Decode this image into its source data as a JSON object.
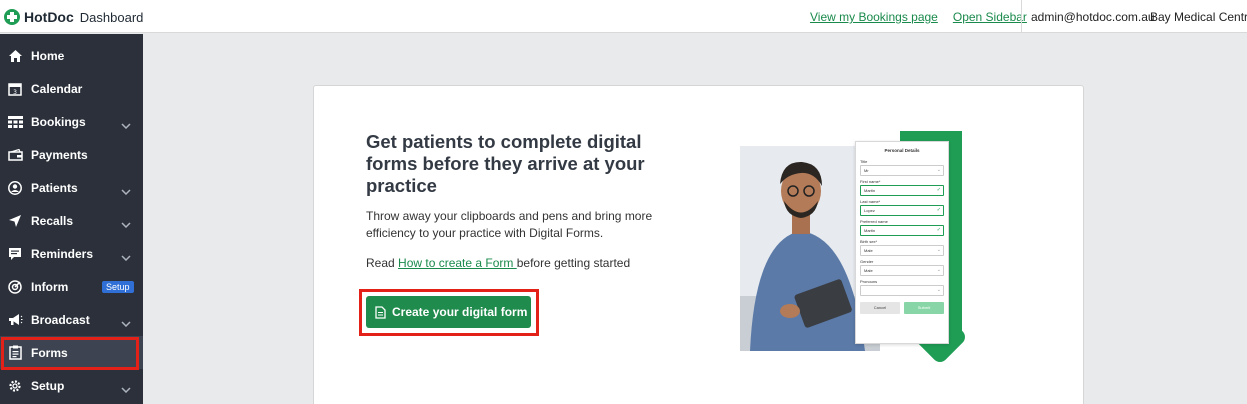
{
  "topbar": {
    "logo_name": "HotDoc",
    "logo_sub": "Dashboard",
    "links": [
      "View my Bookings page",
      "Open Sidebar"
    ],
    "email": "admin@hotdoc.com.au",
    "practice": "Bay Medical Centre"
  },
  "sidebar": {
    "items": [
      {
        "label": "Home",
        "icon": "home-icon",
        "chevron": false
      },
      {
        "label": "Calendar",
        "icon": "calendar-icon",
        "chevron": false
      },
      {
        "label": "Bookings",
        "icon": "bookings-icon",
        "chevron": true
      },
      {
        "label": "Payments",
        "icon": "payments-icon",
        "chevron": false
      },
      {
        "label": "Patients",
        "icon": "patients-icon",
        "chevron": true
      },
      {
        "label": "Recalls",
        "icon": "recalls-icon",
        "chevron": true
      },
      {
        "label": "Reminders",
        "icon": "reminders-icon",
        "chevron": true
      },
      {
        "label": "Inform",
        "icon": "inform-icon",
        "chevron": false,
        "badge": "Setup"
      },
      {
        "label": "Broadcast",
        "icon": "broadcast-icon",
        "chevron": true
      },
      {
        "label": "Forms",
        "icon": "forms-icon",
        "chevron": false,
        "active": true
      },
      {
        "label": "Setup",
        "icon": "setup-icon",
        "chevron": true
      }
    ]
  },
  "main": {
    "heading": "Get patients to complete digital forms before they arrive at your practice",
    "description": "Throw away your clipboards and pens and bring more efficiency to your practice with Digital Forms.",
    "read_prefix": "Read ",
    "read_link": "How to create a Form ",
    "read_suffix": "before getting started",
    "cta_label": "Create your digital form"
  },
  "illustration": {
    "form_title": "Personal Details",
    "fields": [
      {
        "label": "Title",
        "value": "Mr",
        "state": "select"
      },
      {
        "label": "First name*",
        "value": "Martin",
        "state": "ok"
      },
      {
        "label": "Last name*",
        "value": "Lopez",
        "state": "ok"
      },
      {
        "label": "Preferred name",
        "value": "Martin",
        "state": "ok"
      },
      {
        "label": "Birth sex*",
        "value": "Male",
        "state": "select"
      },
      {
        "label": "Gender",
        "value": "Male",
        "state": "select"
      },
      {
        "label": "Pronouns",
        "value": "",
        "state": "select"
      }
    ],
    "cancel": "Cancel",
    "submit": "Submit"
  },
  "colors": {
    "brand_green": "#1f8b4c",
    "sidebar_bg": "#2b303a",
    "highlight_red": "#e32119",
    "badge_blue": "#2f6fd6"
  }
}
